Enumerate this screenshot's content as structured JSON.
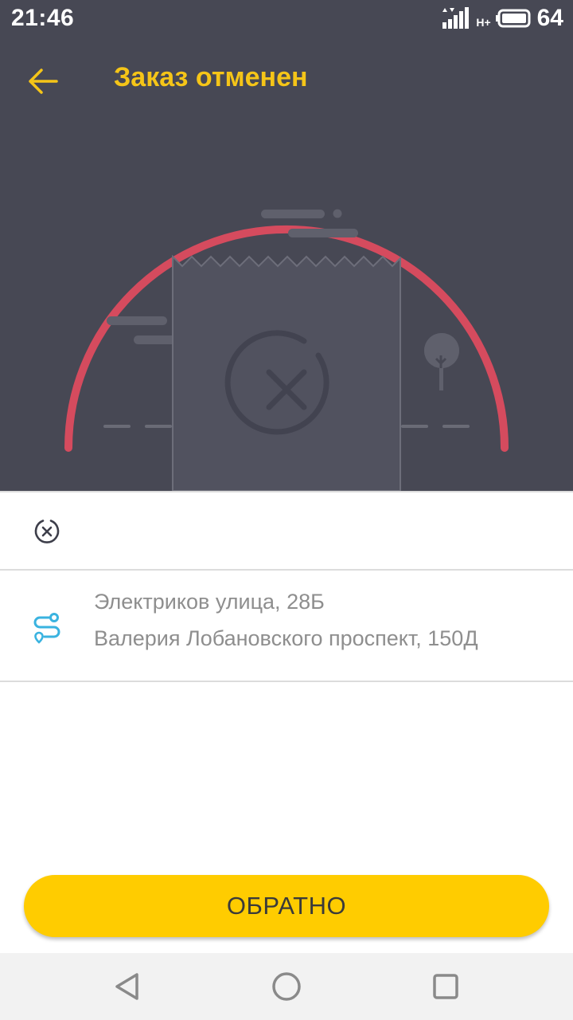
{
  "status_bar": {
    "time": "21:46",
    "network": "H+",
    "battery": "64"
  },
  "header": {
    "title": "Заказ отменен",
    "accent_color": "#f5c518",
    "background_color": "#474854"
  },
  "order": {
    "status_icon": "cancel-circle-icon",
    "route_icon": "route-icon",
    "from_address": "Электриков улица, 28Б",
    "to_address": "Валерия Лобановского проспект, 150Д"
  },
  "illustration": {
    "arc_color": "#d54b5e",
    "center_icon": "cancel-circle-icon"
  },
  "actions": {
    "back_label": "ОБРАТНО",
    "button_color": "#ffcc00"
  },
  "navigation_bar": {
    "back_icon": "triangle-back-icon",
    "home_icon": "circle-home-icon",
    "recent_icon": "square-recent-icon"
  }
}
